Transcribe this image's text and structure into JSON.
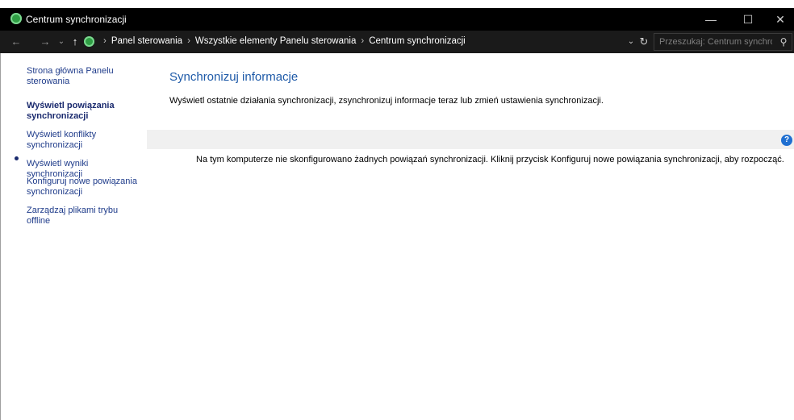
{
  "window": {
    "title": "Centrum synchronizacji",
    "controls": {
      "minimize": "—",
      "maximize": "☐",
      "close": "✕"
    }
  },
  "navbar": {
    "back": "←",
    "forward": "→",
    "recent": "⌄",
    "up": "↑",
    "breadcrumb": [
      "Panel sterowania",
      "Wszystkie elementy Panelu sterowania",
      "Centrum synchronizacji"
    ],
    "separator": "›",
    "dropdown": "⌄",
    "refresh": "↻",
    "search_placeholder": "Przeszukaj: Centrum synchroni...",
    "search_icon": "⚲"
  },
  "sidebar": {
    "items": [
      {
        "label": "Strona główna Panelu sterowania",
        "current": false
      },
      {
        "label": "Wyświetl powiązania synchronizacji",
        "current": true
      },
      {
        "label": "Wyświetl konflikty synchronizacji",
        "current": false
      },
      {
        "label": "Wyświetl wyniki synchronizacji",
        "current": false
      },
      {
        "label": "Konfiguruj nowe powiązania synchronizacji",
        "current": false
      },
      {
        "label": "Zarządzaj plikami trybu offline",
        "current": false
      }
    ]
  },
  "main": {
    "heading": "Synchronizuj informacje",
    "description": "Wyświetl ostatnie działania synchronizacji, zsynchronizuj informacje teraz lub zmień ustawienia synchronizacji.",
    "help_icon": "?",
    "empty_message": "Na tym komputerze nie skonfigurowano żadnych powiązań synchronizacji. Kliknij przycisk Konfiguruj nowe powiązania synchronizacji, aby rozpocząć."
  },
  "colors": {
    "titlebar": "#000000",
    "navbar": "#1a1a1a",
    "link": "#1e3b8a",
    "heading": "#1e5aa8",
    "band": "#f0f0f0",
    "help": "#1f6fd1",
    "sync_icon": "#2f9e44"
  }
}
